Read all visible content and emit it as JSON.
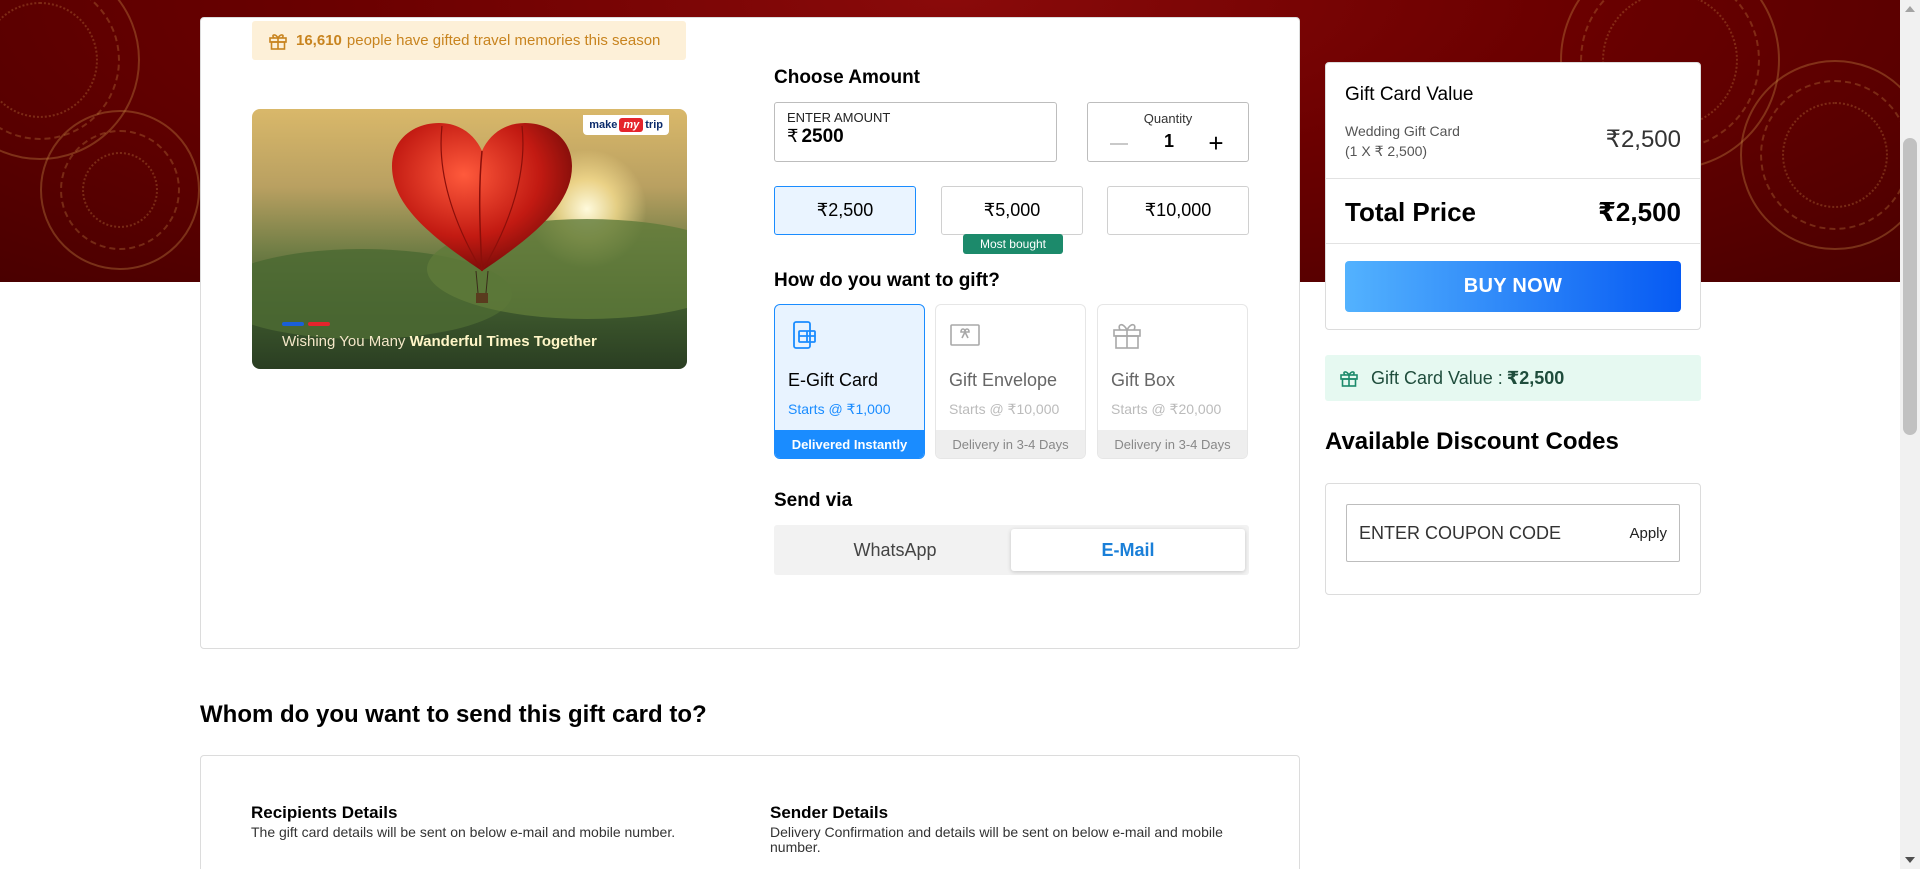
{
  "banner": {
    "count": "16,610",
    "text": "people have gifted travel memories this season"
  },
  "card_image": {
    "logo_make": "make",
    "logo_my": "my",
    "logo_trip": "trip",
    "tagline_plain": "Wishing You Many",
    "tagline_bold": "Wanderful Times Together"
  },
  "amount": {
    "section_title": "Choose Amount",
    "input_label": "ENTER AMOUNT",
    "currency": "₹",
    "input_value": "2500",
    "quantity_label": "Quantity",
    "quantity_value": "1",
    "presets": [
      {
        "label": "₹2,500",
        "selected": true
      },
      {
        "label": "₹5,000",
        "selected": false
      },
      {
        "label": "₹10,000",
        "selected": false
      }
    ],
    "most_bought": "Most bought"
  },
  "gift_type": {
    "section_title": "How do you want to gift?",
    "options": [
      {
        "name": "E-Gift Card",
        "price": "Starts @ ₹1,000",
        "footer": "Delivered Instantly",
        "icon": "e-gift-card-icon",
        "selected": true
      },
      {
        "name": "Gift Envelope",
        "price": "Starts @ ₹10,000",
        "footer": "Delivery in 3-4 Days",
        "icon": "envelope-icon",
        "selected": false
      },
      {
        "name": "Gift Box",
        "price": "Starts @ ₹20,000",
        "footer": "Delivery in 3-4 Days",
        "icon": "gift-box-icon",
        "selected": false
      }
    ]
  },
  "send_via": {
    "section_title": "Send via",
    "tabs": [
      {
        "label": "WhatsApp",
        "active": false
      },
      {
        "label": "E-Mail",
        "active": true
      }
    ]
  },
  "recipients": {
    "section_title": "Whom do you want to send this gift card to?",
    "recipient_heading": "Recipients Details",
    "recipient_text": "The gift card details will be sent on below e-mail and mobile number.",
    "sender_heading": "Sender Details",
    "sender_text": "Delivery Confirmation and details will be sent on below e-mail and mobile number."
  },
  "summary": {
    "title": "Gift Card Value",
    "item_name": "Wedding Gift Card",
    "item_qty": "(1 X ₹ 2,500)",
    "item_amount": "₹2,500",
    "total_label": "Total Price",
    "total_amount": "₹2,500",
    "buy_label": "BUY NOW"
  },
  "value_strip": {
    "label": "Gift Card Value :",
    "amount": "₹2,500"
  },
  "discount": {
    "title": "Available Discount Codes",
    "placeholder": "ENTER COUPON CODE",
    "apply_label": "Apply"
  },
  "colors": {
    "accent_blue": "#1a8cff",
    "banner_red": "#6b0000",
    "most_bought_green": "#1c8a6b",
    "promo_orange": "#c8841f"
  }
}
